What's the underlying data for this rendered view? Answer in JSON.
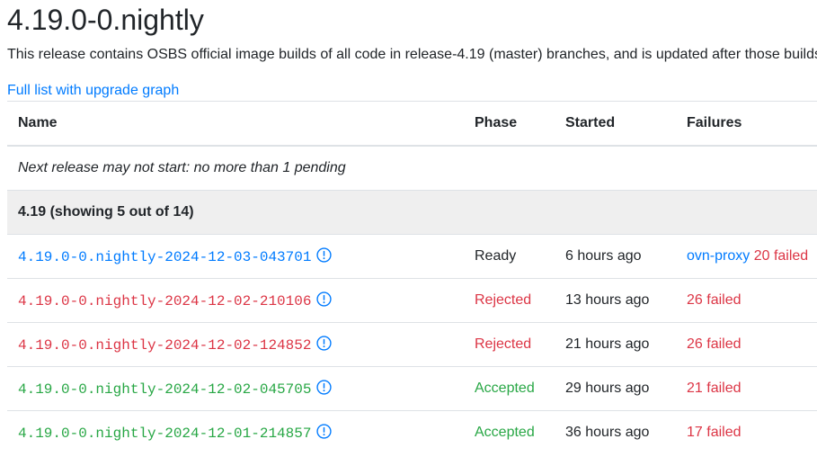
{
  "page": {
    "title": "4.19.0-0.nightly",
    "description": "This release contains OSBS official image builds of all code in release-4.19 (master) branches, and is updated after those builds are synced to quay.io.",
    "graph_link": "Full list with upgrade graph"
  },
  "table": {
    "headers": {
      "name": "Name",
      "phase": "Phase",
      "started": "Started",
      "failures": "Failures"
    },
    "pending_note": "Next release may not start: no more than 1 pending",
    "group_label": "4.19 (showing 5 out of 14)",
    "rows": [
      {
        "name": "4.19.0-0.nightly-2024-12-03-043701",
        "phase": "Ready",
        "started": "6 hours ago",
        "failing_component": "ovn-proxy",
        "failures": "20 failed"
      },
      {
        "name": "4.19.0-0.nightly-2024-12-02-210106",
        "phase": "Rejected",
        "started": "13 hours ago",
        "failures": "26 failed"
      },
      {
        "name": "4.19.0-0.nightly-2024-12-02-124852",
        "phase": "Rejected",
        "started": "21 hours ago",
        "failures": "26 failed"
      },
      {
        "name": "4.19.0-0.nightly-2024-12-02-045705",
        "phase": "Accepted",
        "started": "29 hours ago",
        "failures": "21 failed"
      },
      {
        "name": "4.19.0-0.nightly-2024-12-01-214857",
        "phase": "Accepted",
        "started": "36 hours ago",
        "failures": "17 failed"
      }
    ]
  },
  "colors": {
    "link": "#007bff",
    "rejected": "#dc3545",
    "accepted": "#28a745",
    "text": "#212529",
    "group_bg": "#efefef"
  },
  "icons": {
    "info": "info-circle-icon"
  }
}
